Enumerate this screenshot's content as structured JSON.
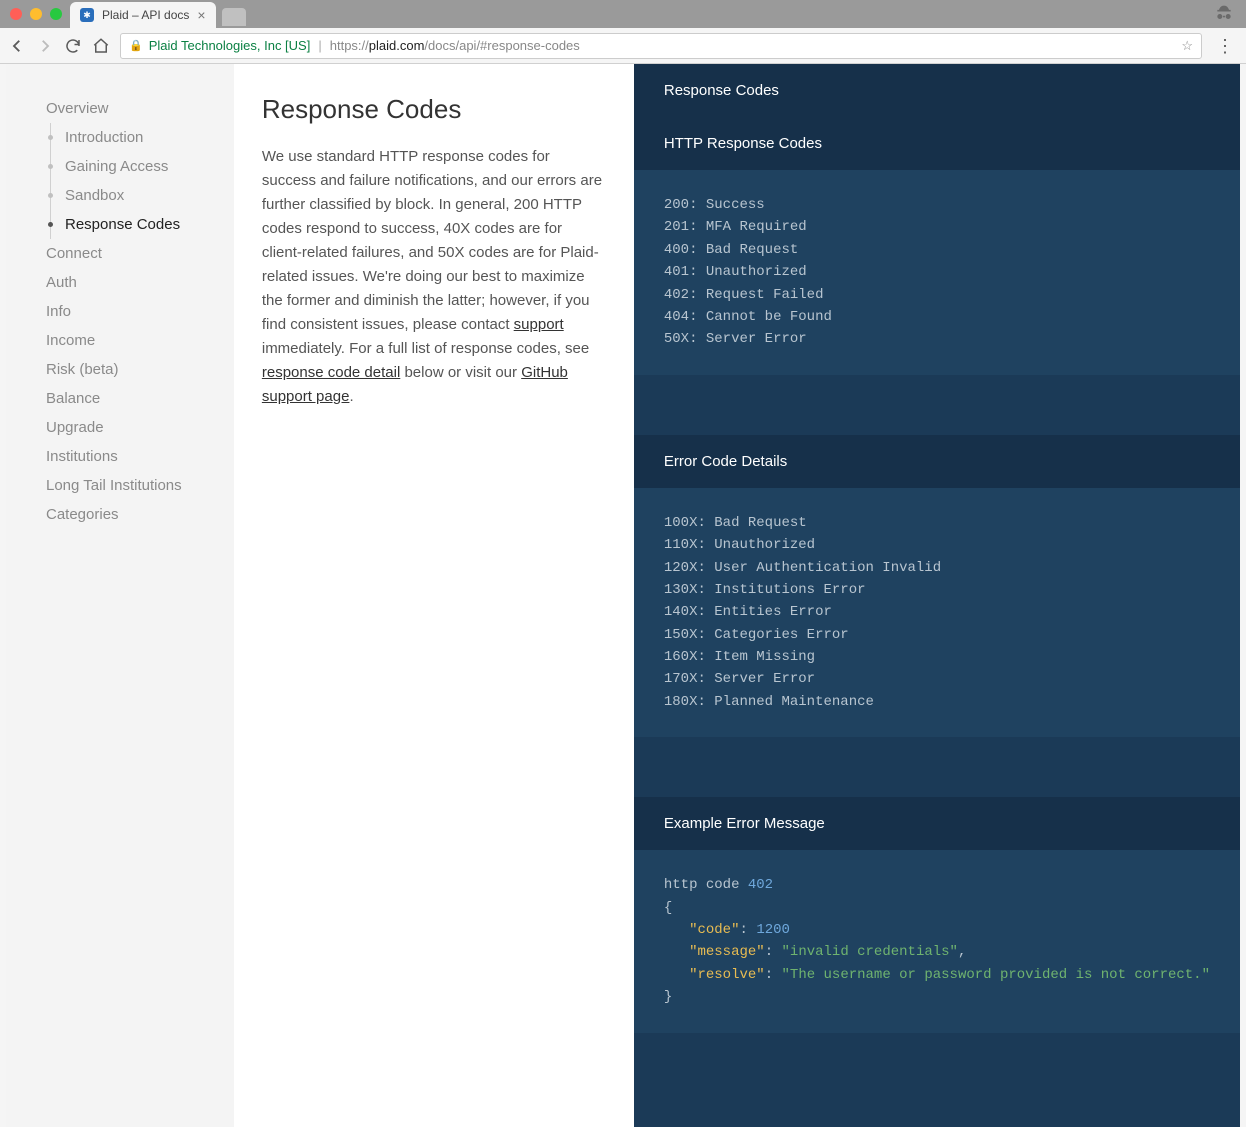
{
  "browser": {
    "tab_title": "Plaid – API docs",
    "org_name": "Plaid Technologies, Inc [US]",
    "url_proto": "https://",
    "url_host": "plaid.com",
    "url_path": "/docs/api/#response-codes"
  },
  "sidebar": {
    "overview": "Overview",
    "subitems": [
      {
        "label": "Introduction"
      },
      {
        "label": "Gaining Access"
      },
      {
        "label": "Sandbox"
      },
      {
        "label": "Response Codes"
      }
    ],
    "items": [
      {
        "label": "Connect"
      },
      {
        "label": "Auth"
      },
      {
        "label": "Info"
      },
      {
        "label": "Income"
      },
      {
        "label": "Risk (beta)"
      },
      {
        "label": "Balance"
      },
      {
        "label": "Upgrade"
      },
      {
        "label": "Institutions"
      },
      {
        "label": "Long Tail Institutions"
      },
      {
        "label": "Categories"
      }
    ]
  },
  "main": {
    "heading": "Response Codes",
    "para_part1": "We use standard HTTP response codes for success and failure notifications, and our errors are further classified by block. In general, 200 HTTP codes respond to success, 40X codes are for client-related failures, and 50X codes are for Plaid-related issues. We're doing our best to maximize the former and diminish the latter; however, if you find consistent issues, please contact ",
    "link_support": "support",
    "para_part2": " immediately. For a full list of response codes, see ",
    "link_detail": "response code detail",
    "para_part3": " below or visit our ",
    "link_github": "GitHub support page",
    "para_part4": "."
  },
  "code_panel": {
    "title1": "Response Codes",
    "title2": "HTTP Response Codes",
    "http_codes": "200: Success\n201: MFA Required\n400: Bad Request\n401: Unauthorized\n402: Request Failed\n404: Cannot be Found\n50X: Server Error",
    "title3": "Error Code Details",
    "error_codes": "100X: Bad Request\n110X: Unauthorized\n120X: User Authentication Invalid\n130X: Institutions Error\n140X: Entities Error\n150X: Categories Error\n160X: Item Missing\n170X: Server Error\n180X: Planned Maintenance",
    "title4": "Example Error Message",
    "example_prefix": "http code ",
    "example_code": "402",
    "example_key_code": "\"code\"",
    "example_val_code": "1200",
    "example_key_message": "\"message\"",
    "example_val_message": "\"invalid credentials\"",
    "example_key_resolve": "\"resolve\"",
    "example_val_resolve": "\"The username or password provided is not correct.\""
  }
}
